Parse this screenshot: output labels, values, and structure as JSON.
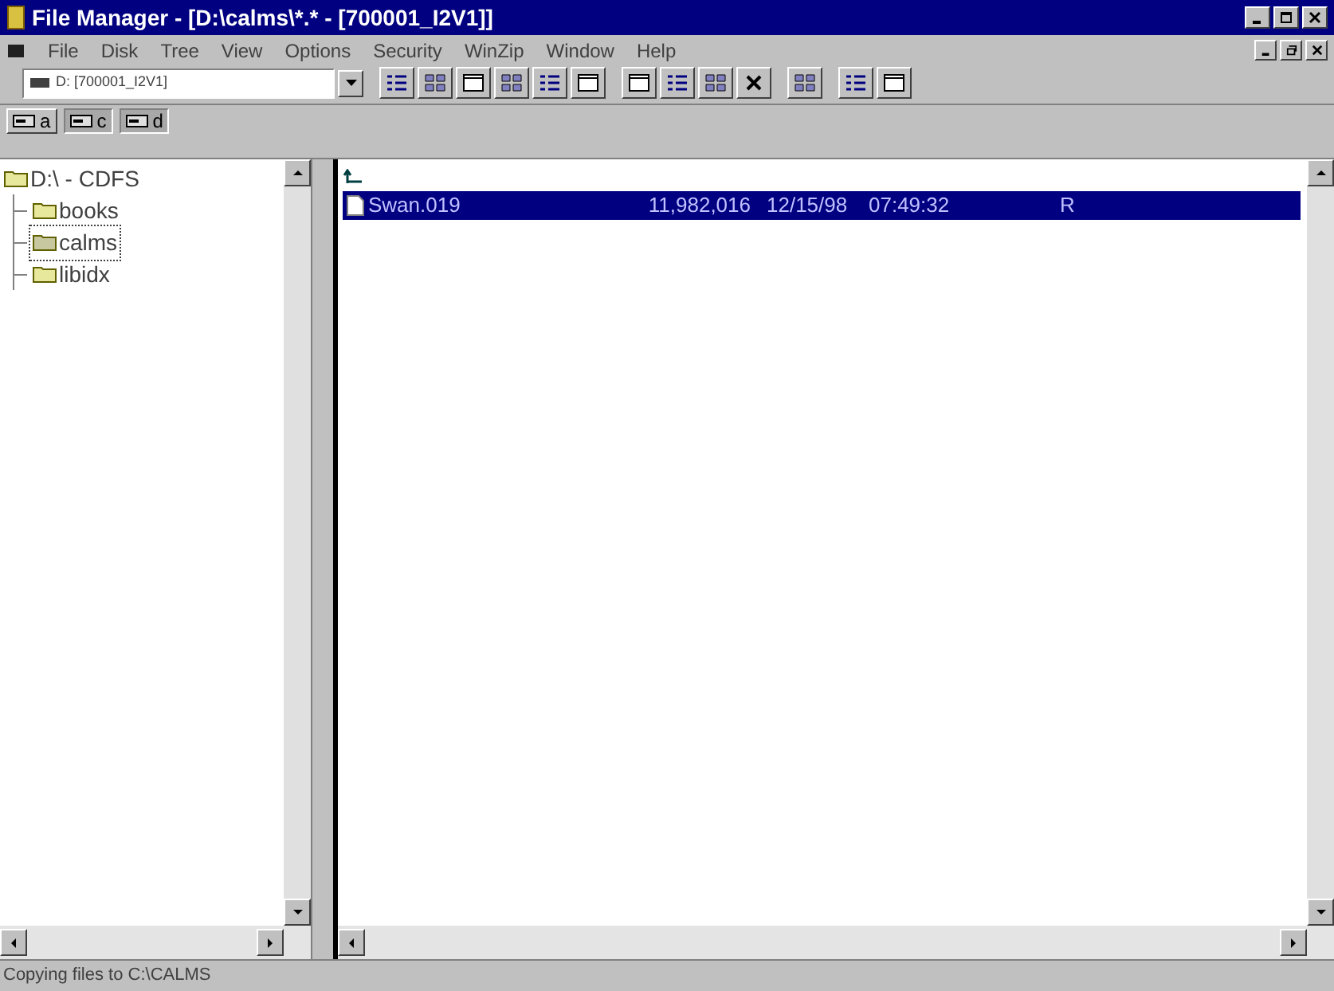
{
  "window": {
    "title": "File Manager - [D:\\calms\\*.* - [700001_I2V1]]"
  },
  "menu": [
    "File",
    "Disk",
    "Tree",
    "View",
    "Options",
    "Security",
    "WinZip",
    "Window",
    "Help"
  ],
  "drive_combo": {
    "value": "D: [700001_I2V1]"
  },
  "drives": [
    {
      "letter": "a",
      "selected": false
    },
    {
      "letter": "c",
      "selected": true
    },
    {
      "letter": "d",
      "selected": true
    }
  ],
  "tree": {
    "label": "D:\\ - CDFS",
    "selected": false,
    "children": [
      {
        "label": "books",
        "selected": false
      },
      {
        "label": "calms",
        "selected": true
      },
      {
        "label": "libidx",
        "selected": false
      }
    ]
  },
  "files": [
    {
      "kind": "parent",
      "selected": false
    },
    {
      "kind": "file",
      "name": "Swan.019",
      "size": "11,982,016",
      "date": "12/15/98",
      "time": "07:49:32",
      "attributes": "R",
      "selected": true
    }
  ],
  "status_bar": "Copying files to C:\\CALMS"
}
